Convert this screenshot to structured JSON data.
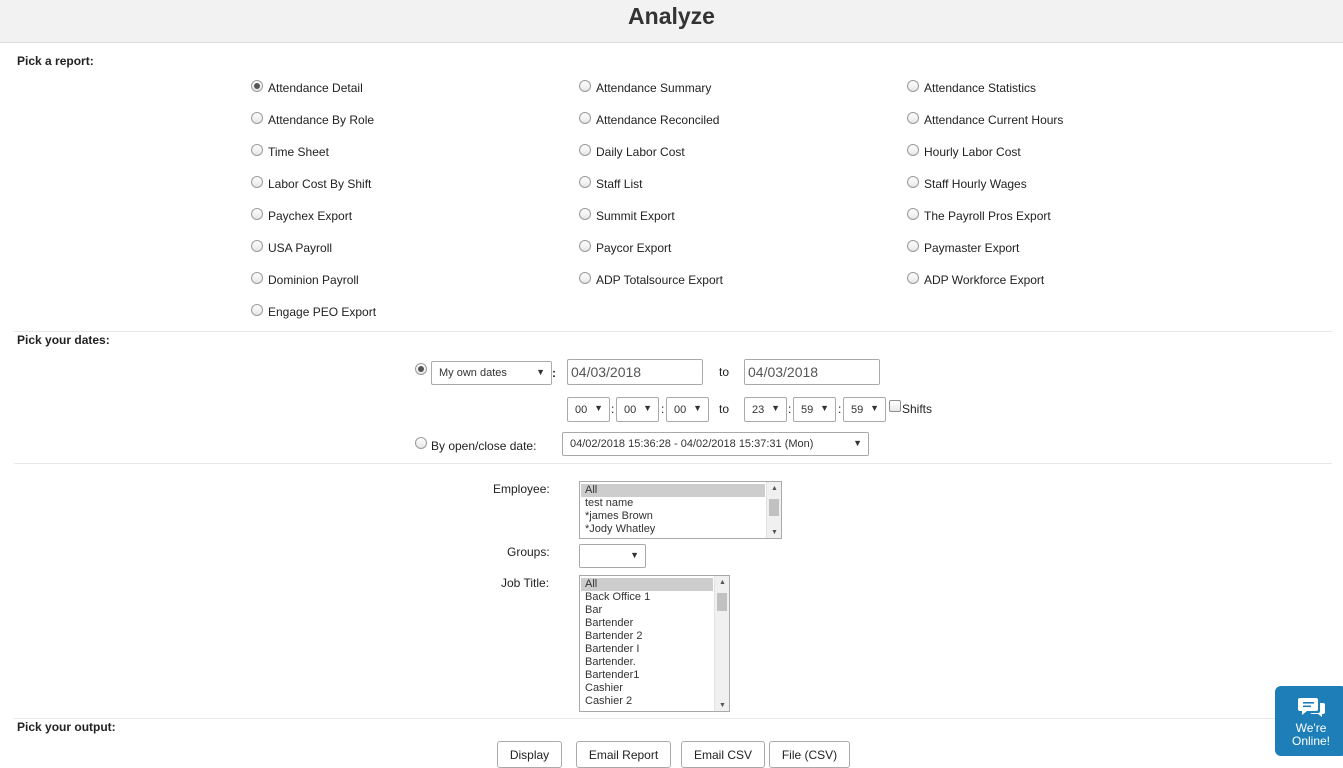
{
  "header": {
    "title": "Analyze"
  },
  "report_section": {
    "label": "Pick a report:",
    "col1": [
      "Attendance Detail",
      "Attendance By Role",
      "Time Sheet",
      "Labor Cost By Shift",
      "Paychex Export",
      "USA Payroll",
      "Dominion Payroll",
      "Engage PEO Export"
    ],
    "col2": [
      "Attendance Summary",
      "Attendance Reconciled",
      "Daily Labor Cost",
      "Staff List",
      "Summit Export",
      "Paycor Export",
      "ADP Totalsource Export"
    ],
    "col3": [
      "Attendance Statistics",
      "Attendance Current Hours",
      "Hourly Labor Cost",
      "Staff Hourly Wages",
      "The Payroll Pros Export",
      "Paymaster Export",
      "ADP Workforce Export"
    ],
    "selected": "Attendance Detail"
  },
  "dates_section": {
    "label": "Pick your dates:",
    "range_select": "My own dates",
    "colon": ":",
    "start_date": "04/03/2018",
    "to_label": "to",
    "end_date": "04/03/2018",
    "start_time": {
      "hour": "00",
      "minute": "00",
      "second": "00"
    },
    "end_time": {
      "hour": "23",
      "minute": "59",
      "second": "59"
    },
    "shifts_label": "Shifts",
    "open_close_label": "By open/close date:",
    "open_close_value": "04/02/2018 15:36:28 - 04/02/2018 15:37:31 (Mon)"
  },
  "filters": {
    "employee_label": "Employee:",
    "employees": [
      "All",
      "test name",
      "*james Brown",
      "*Jody Whatley"
    ],
    "groups_label": "Groups:",
    "groups_value": "",
    "job_title_label": "Job Title:",
    "job_titles": [
      "All",
      "Back Office 1",
      "Bar",
      "Bartender",
      "Bartender 2",
      "Bartender I",
      "Bartender.",
      "Bartender1",
      "Cashier",
      "Cashier 2"
    ]
  },
  "output_section": {
    "label": "Pick your output:",
    "buttons": [
      "Display",
      "Email Report",
      "Email CSV",
      "File (CSV)"
    ]
  },
  "chat_widget": {
    "line1": "We're",
    "line2": "Online!"
  },
  "icons": {
    "radio": "radio-icon",
    "dropdown": "chevron-down-icon",
    "chat": "chat-bubbles-icon"
  },
  "colors": {
    "chat_bg": "#1e7fb8",
    "header_bg": "#f2f2f2"
  }
}
